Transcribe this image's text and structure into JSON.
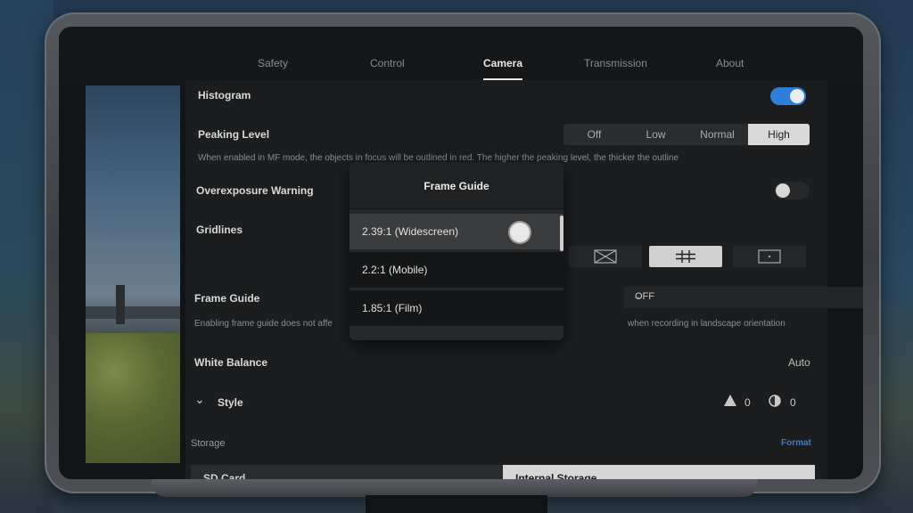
{
  "tabs": [
    {
      "label": "Safety"
    },
    {
      "label": "Control"
    },
    {
      "label": "Camera"
    },
    {
      "label": "Transmission"
    },
    {
      "label": "About"
    }
  ],
  "settings": {
    "histogram": {
      "label": "Histogram",
      "enabled": true
    },
    "peaking": {
      "label": "Peaking Level",
      "options": [
        "Off",
        "Low",
        "Normal",
        "High"
      ],
      "selected": "High",
      "description": "When enabled in MF mode, the objects in focus will be outlined in red. The higher the peaking level, the thicker the outline"
    },
    "overexposure": {
      "label": "Overexposure Warning",
      "enabled": false
    },
    "gridlines": {
      "label": "Gridlines"
    },
    "frame_guide": {
      "label": "Frame Guide",
      "value": "OFF",
      "description_left": "Enabling frame guide does not affe",
      "description_right": "when recording in landscape orientation"
    },
    "white_balance": {
      "label": "White Balance",
      "value": "Auto"
    },
    "style": {
      "label": "Style",
      "sharpness": "0",
      "contrast": "0"
    }
  },
  "storage": {
    "label": "Storage",
    "format_label": "Format",
    "sd_card": "SD Card",
    "internal": "Internal Storage"
  },
  "modal": {
    "title": "Frame Guide",
    "options": [
      "2.39:1 (Widescreen)",
      "2.2:1 (Mobile)",
      "1.85:1 (Film)"
    ],
    "selected": "2.39:1 (Widescreen)"
  },
  "colors": {
    "accent": "#2d7fd9",
    "format_link": "#2f7fd8"
  }
}
